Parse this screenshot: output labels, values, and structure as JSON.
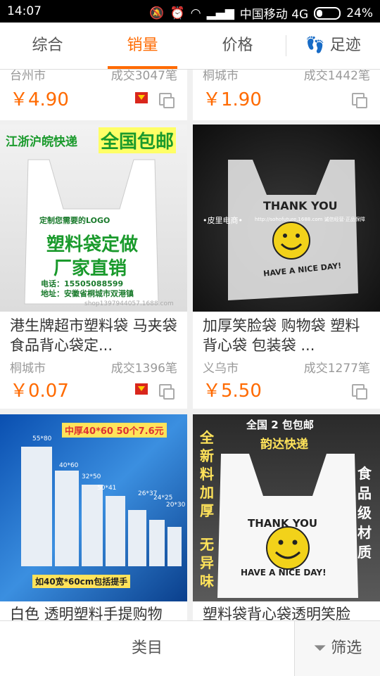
{
  "status": {
    "time": "14:07",
    "carrier": "中国移动 4G",
    "battery": "24%"
  },
  "tabs": [
    {
      "label": "综合"
    },
    {
      "label": "销量"
    },
    {
      "label": "价格"
    },
    {
      "label": "足迹"
    }
  ],
  "products": [
    {
      "location": "台州市",
      "deals": "成交3047笔",
      "price": "￥4.90"
    },
    {
      "location": "桐城市",
      "deals": "成交1442笔",
      "price": "￥1.90"
    },
    {
      "title": "港生牌超市塑料袋 马夹袋食品背心袋定...",
      "location": "桐城市",
      "deals": "成交1396笔",
      "price": "￥0.07",
      "img": {
        "top_left": "江浙沪皖快递",
        "top_right": "全国包邮",
        "line1": "定制您需要的LOGO",
        "line2": "塑料袋定做",
        "line3": "厂家直销",
        "phone": "电话：15505088599",
        "addr": "地址：安徽省桐城市双港镇",
        "wm": "shop1397944057.1688.com"
      }
    },
    {
      "title": "加厚笑脸袋 购物袋 塑料背心袋 包装袋 ...",
      "location": "义乌市",
      "deals": "成交1277笔",
      "price": "￥5.50",
      "img": {
        "thank": "THANK YOU",
        "nice": "HAVE A NICE DAY!",
        "shop": "•皮里电商•",
        "url": "http://sohofuture.1688.com 诚信经营·正品保障"
      }
    },
    {
      "title": "白色 透明塑料手提购物",
      "img": {
        "banner": "中厚40*60 50个7.6元",
        "foot": "如40宽*60cm包括提手",
        "sizes": [
          "55*80",
          "40*60",
          "32*50",
          "50*41",
          "26*37",
          "24*25",
          "20*30"
        ]
      }
    },
    {
      "title": "塑料袋背心袋透明笑脸",
      "img": {
        "top1": "全国 2 包包邮",
        "top2": "韵达快递",
        "left": "全新料加厚",
        "left2": "无异味",
        "right": "食品级材质",
        "thank": "THANK YOU",
        "nice": "HAVE A NICE DAY!"
      }
    }
  ],
  "bottom": {
    "category": "类目",
    "filter": "筛选"
  },
  "colors": {
    "accent": "#ff6a00"
  }
}
